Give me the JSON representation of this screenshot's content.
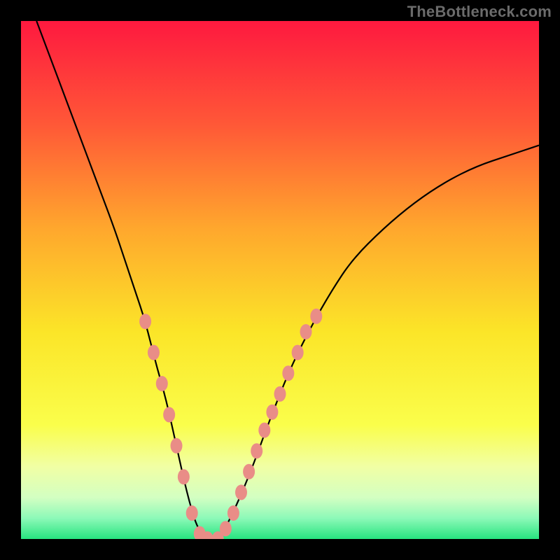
{
  "watermark": "TheBottleneck.com",
  "colors": {
    "black": "#000000",
    "curve": "#000000",
    "marker": "#e98d87"
  },
  "chart_data": {
    "type": "line",
    "title": "",
    "xlabel": "",
    "ylabel": "",
    "xlim": [
      0,
      100
    ],
    "ylim": [
      0,
      100
    ],
    "grid": false,
    "gradient_stops": [
      {
        "pct": 0,
        "color": "#fe193f"
      },
      {
        "pct": 20,
        "color": "#ff5837"
      },
      {
        "pct": 40,
        "color": "#ffa72d"
      },
      {
        "pct": 60,
        "color": "#fbe528"
      },
      {
        "pct": 78,
        "color": "#fafe4b"
      },
      {
        "pct": 86,
        "color": "#f1ffa4"
      },
      {
        "pct": 92,
        "color": "#d3ffc2"
      },
      {
        "pct": 96,
        "color": "#8cf9b8"
      },
      {
        "pct": 100,
        "color": "#27e47f"
      }
    ],
    "series": [
      {
        "name": "bottleneck-curve",
        "x": [
          3,
          6,
          9,
          12,
          15,
          18,
          20,
          22,
          24,
          26,
          28,
          30,
          32,
          34,
          36,
          38,
          40,
          44,
          48,
          52,
          56,
          60,
          64,
          70,
          76,
          82,
          88,
          94,
          100
        ],
        "y": [
          100,
          92,
          84,
          76,
          68,
          60,
          54,
          48,
          42,
          34,
          27,
          18,
          9,
          2,
          0,
          0,
          3,
          12,
          23,
          33,
          41,
          48,
          54,
          60,
          65,
          69,
          72,
          74,
          76
        ]
      }
    ],
    "markers": [
      {
        "x": 24.0,
        "y": 42.0
      },
      {
        "x": 25.6,
        "y": 36.0
      },
      {
        "x": 27.2,
        "y": 30.0
      },
      {
        "x": 28.6,
        "y": 24.0
      },
      {
        "x": 30.0,
        "y": 18.0
      },
      {
        "x": 31.4,
        "y": 12.0
      },
      {
        "x": 33.0,
        "y": 5.0
      },
      {
        "x": 34.5,
        "y": 1.0
      },
      {
        "x": 36.0,
        "y": 0.0
      },
      {
        "x": 38.0,
        "y": 0.0
      },
      {
        "x": 39.5,
        "y": 2.0
      },
      {
        "x": 41.0,
        "y": 5.0
      },
      {
        "x": 42.5,
        "y": 9.0
      },
      {
        "x": 44.0,
        "y": 13.0
      },
      {
        "x": 45.5,
        "y": 17.0
      },
      {
        "x": 47.0,
        "y": 21.0
      },
      {
        "x": 48.5,
        "y": 24.5
      },
      {
        "x": 50.0,
        "y": 28.0
      },
      {
        "x": 51.6,
        "y": 32.0
      },
      {
        "x": 53.4,
        "y": 36.0
      },
      {
        "x": 55.0,
        "y": 40.0
      },
      {
        "x": 57.0,
        "y": 43.0
      }
    ]
  }
}
